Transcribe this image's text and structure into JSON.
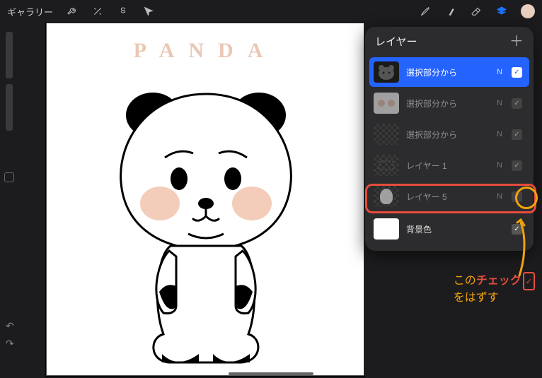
{
  "topbar": {
    "gallery": "ギャラリー"
  },
  "panel": {
    "title": "レイヤー"
  },
  "layers": [
    {
      "label": "選択部分から",
      "blend": "N"
    },
    {
      "label": "選択部分から",
      "blend": "N"
    },
    {
      "label": "選択部分から",
      "blend": "N"
    },
    {
      "label": "レイヤー 1",
      "blend": "N"
    },
    {
      "label": "レイヤー 5",
      "blend": "N"
    },
    {
      "label": "背景色"
    }
  ],
  "canvas": {
    "title_text": "PANDA"
  },
  "annotation": {
    "line1_pre": "この",
    "line1_hl": "チェック",
    "line2": "をはずす"
  }
}
